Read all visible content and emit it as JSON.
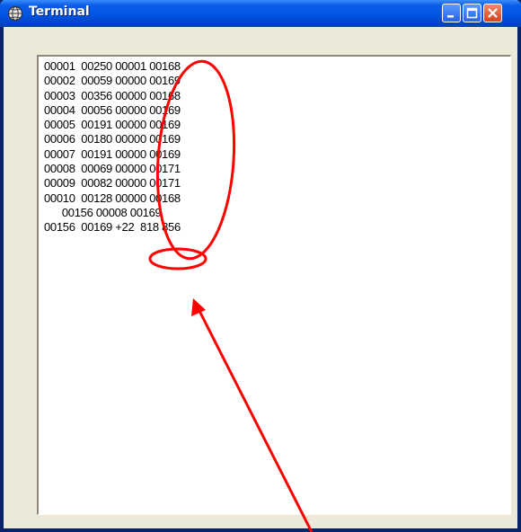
{
  "window": {
    "title": "Terminal",
    "icon": "app-globe-icon",
    "controls": [
      "minimize-icon",
      "maximize-icon",
      "close-icon"
    ]
  },
  "terminal": {
    "lines": [
      "00001  00250 00001 00168",
      "00002  00059 00000 00169",
      "00003  00356 00000 00168",
      "00004  00056 00000 00169",
      "00005  00191 00000 00169",
      "00006  00180 00000 00169",
      "00007  00191 00000 00169",
      "00008  00069 00000 00171",
      "00009  00082 00000 00171",
      "00010  00128 00000 00168",
      "      00156 00008 00169",
      "00156  00169 +22  818 856"
    ]
  },
  "annotations": {
    "color": "#ff0000",
    "shapes": [
      "ellipse-column-highlight",
      "ellipse-value-highlight",
      "arrow-pointer"
    ]
  }
}
